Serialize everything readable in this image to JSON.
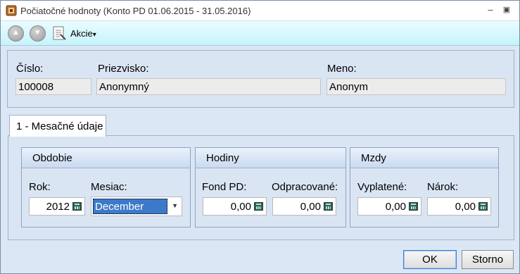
{
  "window": {
    "title": "Počiatočné hodnoty (Konto PD 01.06.2015 - 31.05.2016)"
  },
  "toolbar": {
    "actions_menu": "Akcie",
    "actions_arrow": "▾"
  },
  "employee": {
    "number_label": "Číslo:",
    "number_value": "100008",
    "surname_label": "Priezvisko:",
    "surname_value": "Anonymný",
    "name_label": "Meno:",
    "name_value": "Anonym"
  },
  "tabs": [
    {
      "label": "1 - Mesačné údaje"
    }
  ],
  "period": {
    "title": "Obdobie",
    "year_label": "Rok:",
    "year_value": "2012",
    "month_label": "Mesiac:",
    "month_value": "December"
  },
  "hours": {
    "title": "Hodiny",
    "fund_label": "Fond PD:",
    "fund_value": "0,00",
    "worked_label": "Odpracované:",
    "worked_value": "0,00"
  },
  "wages": {
    "title": "Mzdy",
    "paid_label": "Vyplatené:",
    "paid_value": "0,00",
    "entitlement_label": "Nárok:",
    "entitlement_value": "0,00"
  },
  "buttons": {
    "ok": "OK",
    "cancel": "Storno"
  },
  "colors": {
    "toolbar": "#c7f3fb",
    "panel": "#dae5f4",
    "selection": "#3c79c9"
  }
}
